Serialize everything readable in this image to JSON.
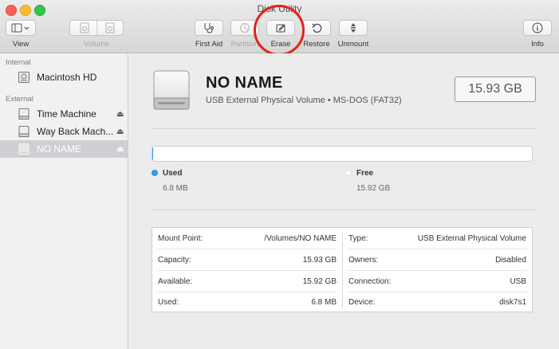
{
  "window": {
    "title": "Disk Utility"
  },
  "toolbar": {
    "view_label": "View",
    "volume_label": "Volume",
    "first_aid_label": "First Aid",
    "partition_label": "Partition",
    "erase_label": "Erase",
    "restore_label": "Restore",
    "unmount_label": "Unmount",
    "info_label": "Info"
  },
  "sidebar": {
    "internal_header": "Internal",
    "external_header": "External",
    "items": [
      {
        "label": "Macintosh HD"
      },
      {
        "label": "Time Machine"
      },
      {
        "label": "Way Back Mach..."
      },
      {
        "label": "NO NAME"
      }
    ],
    "eject_glyph": "⏏"
  },
  "volume": {
    "name": "NO NAME",
    "subtitle": "USB External Physical Volume • MS-DOS (FAT32)",
    "size": "15.93 GB",
    "used_fraction": 0.0004
  },
  "legend": {
    "used_label": "Used",
    "used_value": "6.8 MB",
    "free_label": "Free",
    "free_value": "15.92 GB"
  },
  "info": {
    "left": [
      {
        "key": "Mount Point:",
        "value": "/Volumes/NO NAME"
      },
      {
        "key": "Capacity:",
        "value": "15.93 GB"
      },
      {
        "key": "Available:",
        "value": "15.92 GB"
      },
      {
        "key": "Used:",
        "value": "6.8 MB"
      }
    ],
    "right": [
      {
        "key": "Type:",
        "value": "USB External Physical Volume"
      },
      {
        "key": "Owners:",
        "value": "Disabled"
      },
      {
        "key": "Connection:",
        "value": "USB"
      },
      {
        "key": "Device:",
        "value": "disk7s1"
      }
    ]
  },
  "colors": {
    "used": "#2e9ce7",
    "highlight": "#e02418",
    "selection": "#cfcfd3"
  }
}
